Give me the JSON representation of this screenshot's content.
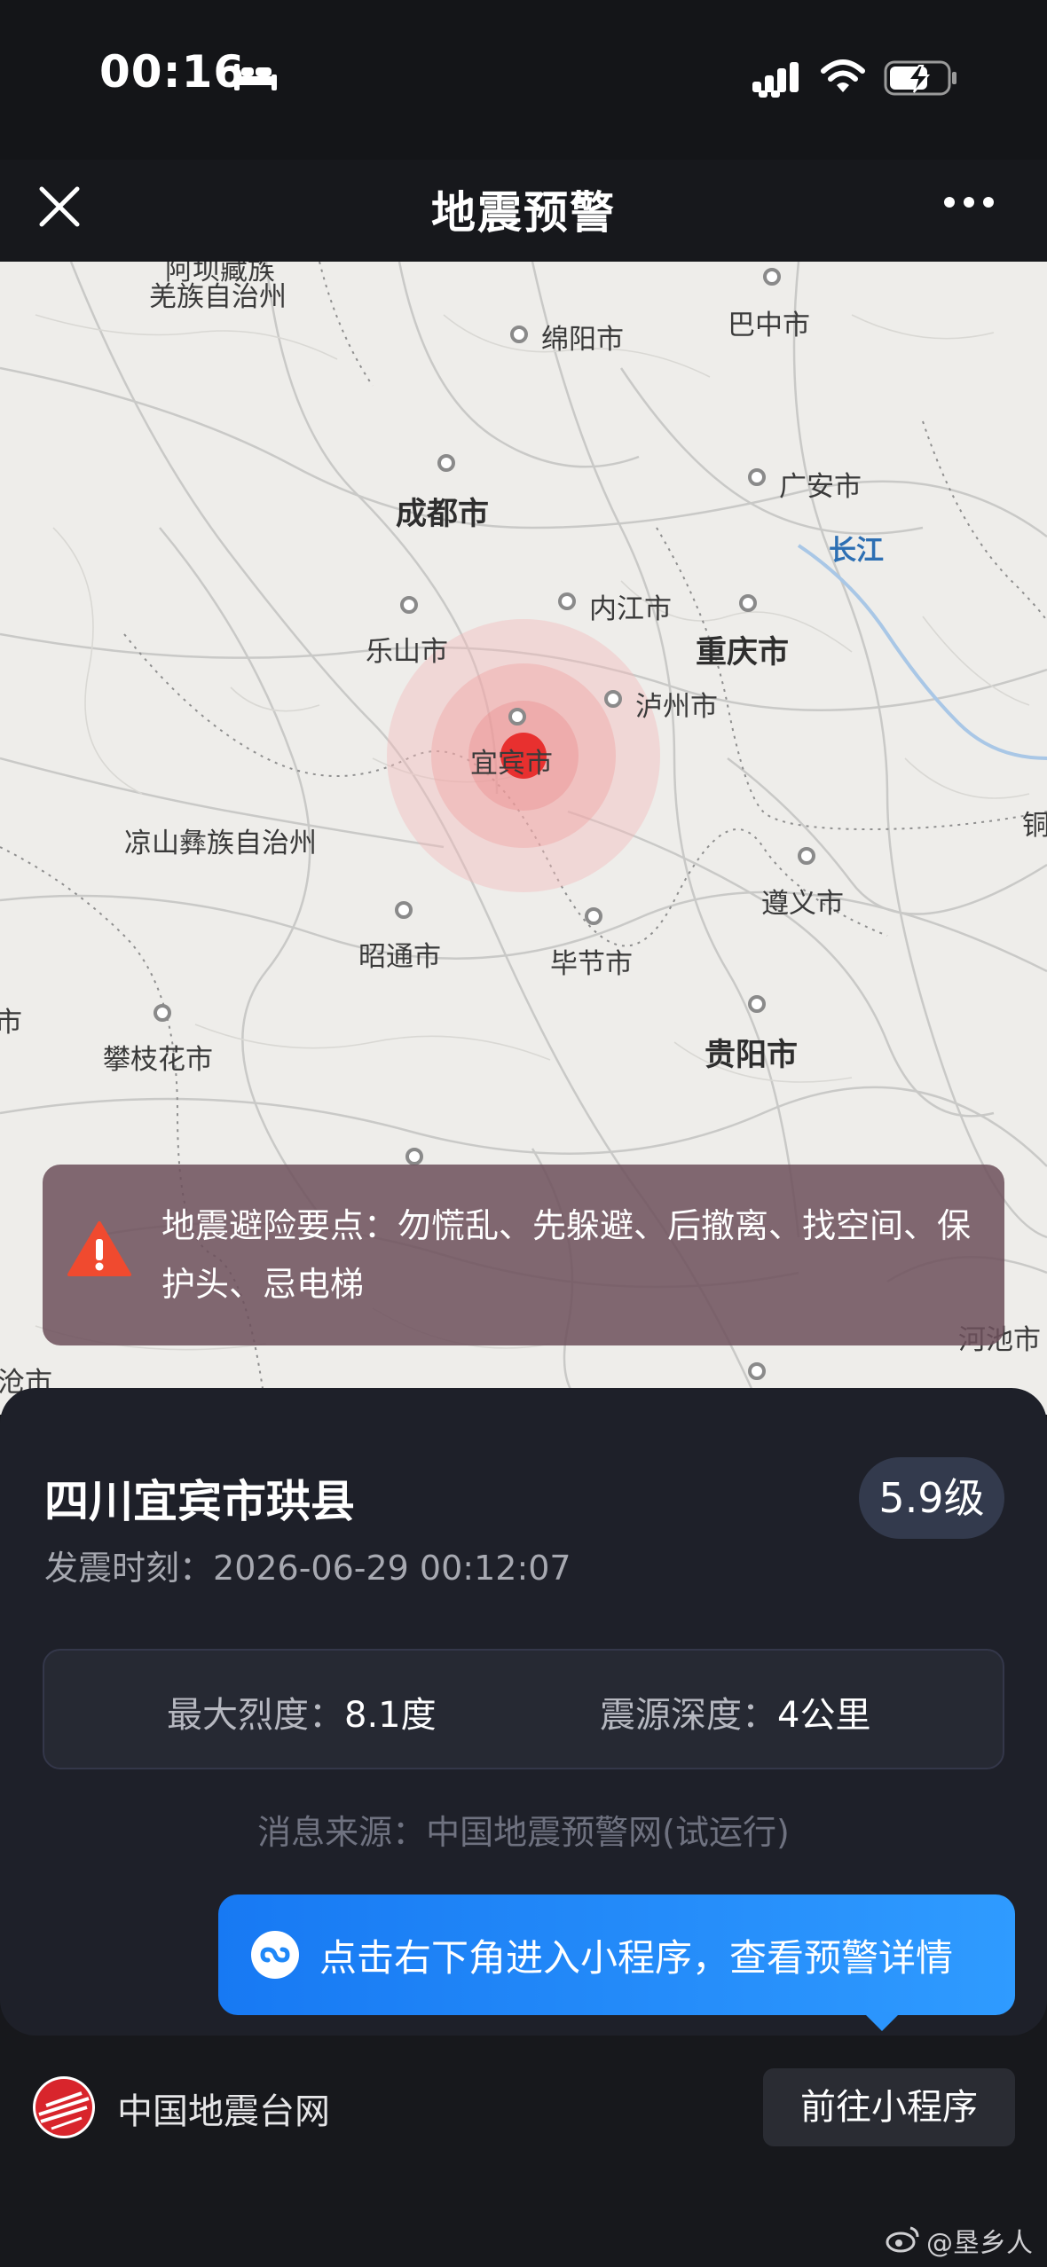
{
  "status_bar": {
    "time": "00:16",
    "icons": [
      "bed-icon",
      "cellular-signal-icon",
      "wifi-icon",
      "battery-charging-icon"
    ]
  },
  "nav": {
    "title": "地震预警",
    "close_icon": "close-icon",
    "more_icon": "more-horizontal-icon"
  },
  "map": {
    "cities": [
      {
        "name": "羌族自治州",
        "major": false
      },
      {
        "name": "阿坝藏族",
        "major": false
      },
      {
        "name": "绵阳市",
        "major": false
      },
      {
        "name": "巴中市",
        "major": false
      },
      {
        "name": "成都市",
        "major": true
      },
      {
        "name": "广安市",
        "major": false
      },
      {
        "name": "长江",
        "major": false
      },
      {
        "name": "内江市",
        "major": false
      },
      {
        "name": "乐山市",
        "major": false
      },
      {
        "name": "重庆市",
        "major": true
      },
      {
        "name": "泸州市",
        "major": false
      },
      {
        "name": "宜宾市",
        "major": false
      },
      {
        "name": "凉山彝族自治州",
        "major": false
      },
      {
        "name": "遵义市",
        "major": false
      },
      {
        "name": "昭通市",
        "major": false
      },
      {
        "name": "毕节市",
        "major": false
      },
      {
        "name": "贵阳市",
        "major": true
      },
      {
        "name": "攀枝花市",
        "major": false
      },
      {
        "name": "临沧市",
        "major": false
      },
      {
        "name": "河池市",
        "major": false
      },
      {
        "name": "铜",
        "major": false
      },
      {
        "name": "市",
        "major": false
      }
    ],
    "epicenter_color": "#e8302f"
  },
  "safety_banner": {
    "icon": "warning-icon",
    "text": "地震避险要点：勿慌乱、先躲避、后撤离、找空间、保护头、忌电梯"
  },
  "quake": {
    "location": "四川宜宾市珙县",
    "magnitude": "5.9级",
    "time_label": "发震时刻：",
    "time_value": "2026-06-29 00:12:07",
    "intensity_label": "最大烈度：",
    "intensity_value": "8.1度",
    "depth_label": "震源深度：",
    "depth_value": "4公里",
    "source": "消息来源：中国地震预警网(试运行)"
  },
  "tooltip": {
    "icon": "mini-program-link-icon",
    "text": "点击右下角进入小程序，查看预警详情"
  },
  "footer": {
    "name": "中国地震台网",
    "button": "前往小程序"
  },
  "watermark": "@垦乡人",
  "colors": {
    "accent_blue": "#1f88f8",
    "alert_red": "#e8302f",
    "card_bg": "#1e2029"
  }
}
